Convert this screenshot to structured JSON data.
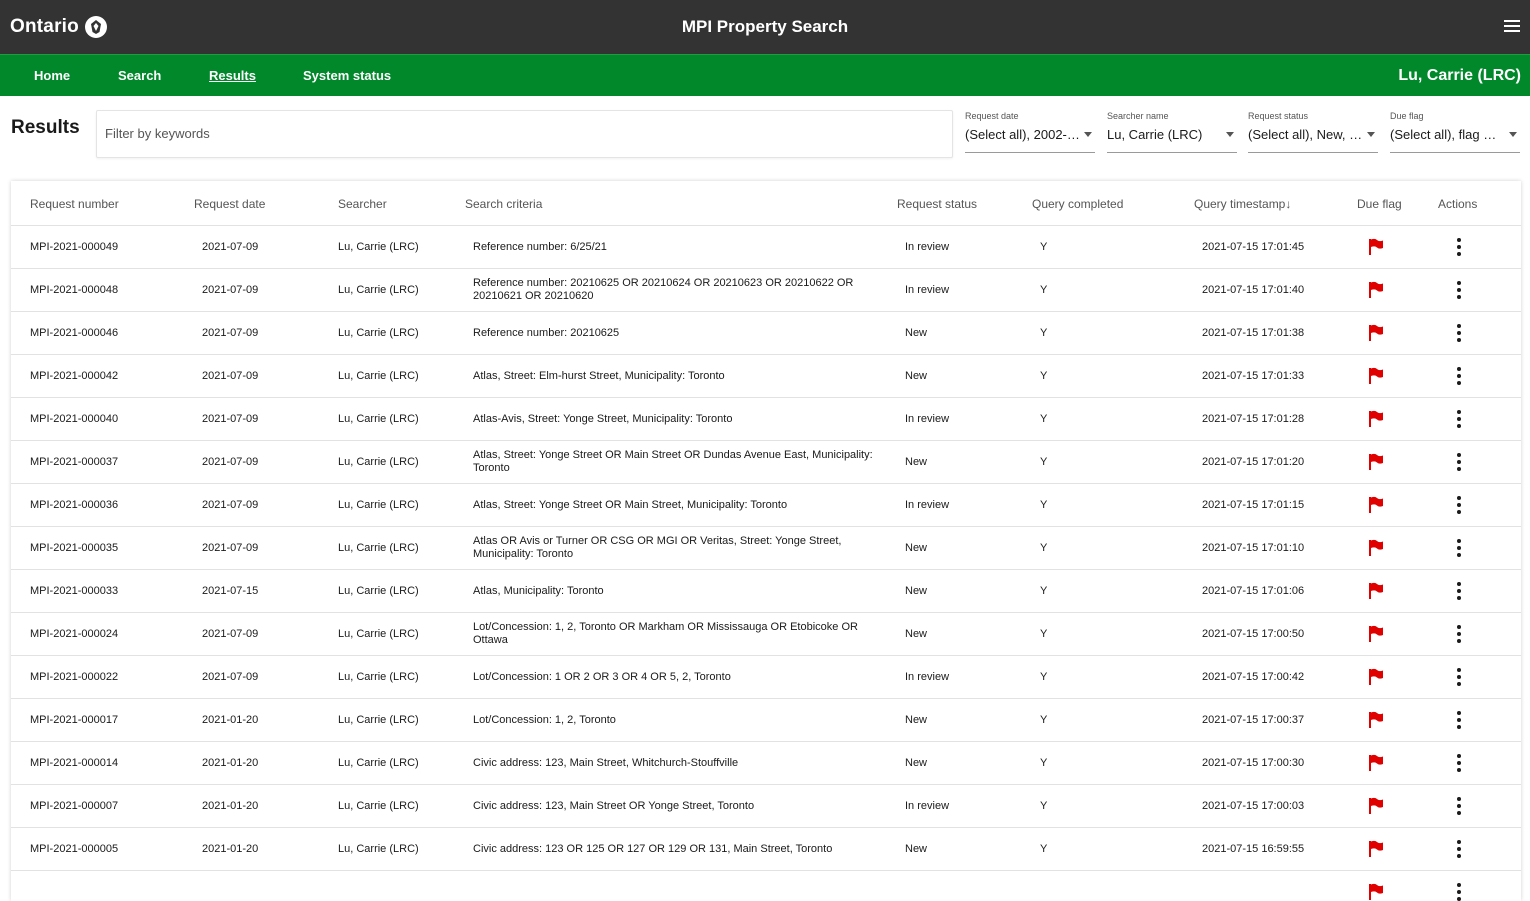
{
  "header": {
    "logo_text": "Ontario",
    "title": "MPI Property Search",
    "menu_icon": "hamburger-menu-icon"
  },
  "nav": {
    "items": [
      {
        "label": "Home",
        "active": false
      },
      {
        "label": "Search",
        "active": false
      },
      {
        "label": "Results",
        "active": true
      },
      {
        "label": "System status",
        "active": false
      }
    ],
    "user": "Lu, Carrie (LRC)"
  },
  "filters": {
    "page_title": "Results",
    "keyword_placeholder": "Filter by keywords",
    "selects": [
      {
        "label": "Request date",
        "value": "(Select all), 2002-…"
      },
      {
        "label": "Searcher name",
        "value": "Lu, Carrie (LRC)"
      },
      {
        "label": "Request status",
        "value": "(Select all), New, I…"
      },
      {
        "label": "Due flag",
        "value": "(Select all), flag R…"
      }
    ]
  },
  "table": {
    "columns": [
      "Request number",
      "Request date",
      "Searcher",
      "Search criteria",
      "Request status",
      "Query completed",
      "Query timestamp↓",
      "Due flag",
      "Actions"
    ],
    "rows": [
      [
        "MPI-2021-000049",
        "2021-07-09",
        "Lu, Carrie (LRC)",
        "Reference number: 6/25/21",
        "In review",
        "Y",
        "2021-07-15 17:01:45"
      ],
      [
        "MPI-2021-000048",
        "2021-07-09",
        "Lu, Carrie (LRC)",
        "Reference number: 20210625 OR 20210624 OR 20210623 OR 20210622 OR 20210621 OR 20210620",
        "In review",
        "Y",
        "2021-07-15 17:01:40"
      ],
      [
        "MPI-2021-000046",
        "2021-07-09",
        "Lu, Carrie (LRC)",
        "Reference number: 20210625",
        "New",
        "Y",
        "2021-07-15 17:01:38"
      ],
      [
        "MPI-2021-000042",
        "2021-07-09",
        "Lu, Carrie (LRC)",
        "Atlas, Street: Elm-hurst Street, Municipality: Toronto",
        "New",
        "Y",
        "2021-07-15 17:01:33"
      ],
      [
        "MPI-2021-000040",
        "2021-07-09",
        "Lu, Carrie (LRC)",
        "Atlas-Avis, Street: Yonge Street, Municipality: Toronto",
        "In review",
        "Y",
        "2021-07-15 17:01:28"
      ],
      [
        "MPI-2021-000037",
        "2021-07-09",
        "Lu, Carrie (LRC)",
        "Atlas, Street: Yonge Street OR Main Street OR Dundas Avenue East, Municipality: Toronto",
        "New",
        "Y",
        "2021-07-15 17:01:20"
      ],
      [
        "MPI-2021-000036",
        "2021-07-09",
        "Lu, Carrie (LRC)",
        "Atlas, Street: Yonge Street OR Main Street, Municipality: Toronto",
        "In review",
        "Y",
        "2021-07-15 17:01:15"
      ],
      [
        "MPI-2021-000035",
        "2021-07-09",
        "Lu, Carrie (LRC)",
        "Atlas OR Avis or Turner OR CSG OR MGI OR Veritas, Street: Yonge Street, Municipality: Toronto",
        "New",
        "Y",
        "2021-07-15 17:01:10"
      ],
      [
        "MPI-2021-000033",
        "2021-07-15",
        "Lu, Carrie (LRC)",
        "Atlas, Municipality: Toronto",
        "New",
        "Y",
        "2021-07-15 17:01:06"
      ],
      [
        "MPI-2021-000024",
        "2021-07-09",
        "Lu, Carrie (LRC)",
        "Lot/Concession: 1, 2, Toronto OR Markham OR Mississauga OR Etobicoke OR Ottawa",
        "New",
        "Y",
        "2021-07-15 17:00:50"
      ],
      [
        "MPI-2021-000022",
        "2021-07-09",
        "Lu, Carrie (LRC)",
        "Lot/Concession: 1 OR 2 OR 3 OR 4 OR 5, 2, Toronto",
        "In review",
        "Y",
        "2021-07-15 17:00:42"
      ],
      [
        "MPI-2021-000017",
        "2021-01-20",
        "Lu, Carrie (LRC)",
        "Lot/Concession: 1, 2, Toronto",
        "New",
        "Y",
        "2021-07-15 17:00:37"
      ],
      [
        "MPI-2021-000014",
        "2021-01-20",
        "Lu, Carrie (LRC)",
        "Civic address: 123, Main Street, Whitchurch-Stouffville",
        "New",
        "Y",
        "2021-07-15 17:00:30"
      ],
      [
        "MPI-2021-000007",
        "2021-01-20",
        "Lu, Carrie (LRC)",
        "Civic address: 123, Main Street OR Yonge Street, Toronto",
        "In review",
        "Y",
        "2021-07-15 17:00:03"
      ],
      [
        "MPI-2021-000005",
        "2021-01-20",
        "Lu, Carrie (LRC)",
        "Civic address: 123 OR 125 OR 127 OR 129 OR 131, Main Street, Toronto",
        "New",
        "Y",
        "2021-07-15 16:59:55"
      ],
      [
        "",
        "",
        "",
        "",
        "",
        "",
        ""
      ]
    ],
    "flag_icon": "red-flag-icon",
    "flag_color": "#e00000",
    "actions_icon": "more-vertical-icon"
  },
  "colors": {
    "topbar": "#333333",
    "navbar": "#00882b"
  }
}
